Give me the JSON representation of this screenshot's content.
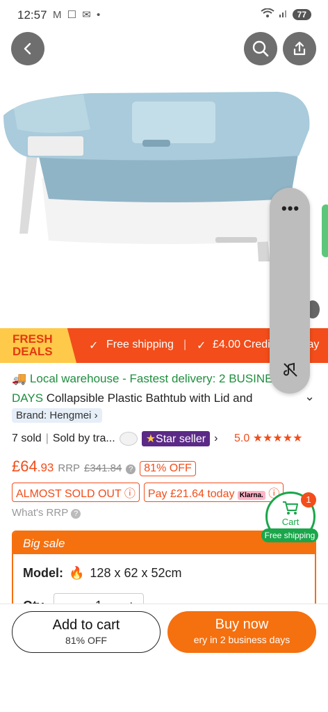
{
  "status_bar": {
    "time": "12:57",
    "icons": "M ☐ ✉ •",
    "battery": "77"
  },
  "product": {
    "warehouse_text": "Local warehouse - Fastest delivery: 2 BUSINESS",
    "days_label": "DAYS",
    "title": "Collapsible Plastic Bathtub with Lid and",
    "brand": "Brand: Hengmei",
    "sold": "7 sold",
    "sold_by": "Sold by tra...",
    "star_seller": "Star seller",
    "rating": "5.0",
    "stars": "★★★★★",
    "price_symbol": "£",
    "price_major": "64",
    "price_minor": ".93",
    "rrp_label": "RRP",
    "rrp_value": "£341.84",
    "discount": "81% OFF",
    "almost_sold_out": "ALMOST SOLD OUT",
    "pay_today": "Pay £21.64 today",
    "klarna": "Klarna.",
    "whats_rrp": "What's RRP"
  },
  "deals_bar": {
    "fresh_line1": "FRESH",
    "fresh_line2": "DEALS",
    "free_shipping": "Free shipping",
    "credit": "£4.00 Credit",
    "delay": "elay"
  },
  "cart_float": {
    "count": "1",
    "label": "Cart",
    "free_shipping": "Free shipping"
  },
  "big_sale": {
    "title": "Big sale",
    "model_label": "Model:",
    "model_value": "128 x 62 x 52cm",
    "qty_label": "Qty",
    "qty_value": "1"
  },
  "actions": {
    "add_to_cart": "Add to cart",
    "add_sub": "81% OFF",
    "buy_now": "Buy now",
    "buy_sub": "ery in 2 business days"
  },
  "colors": {
    "accent": "#f24d1a",
    "fresh_deals": "#ffc94a",
    "buy": "#f5700f",
    "green": "#1e8e3e",
    "star_seller": "#5b2a86"
  }
}
